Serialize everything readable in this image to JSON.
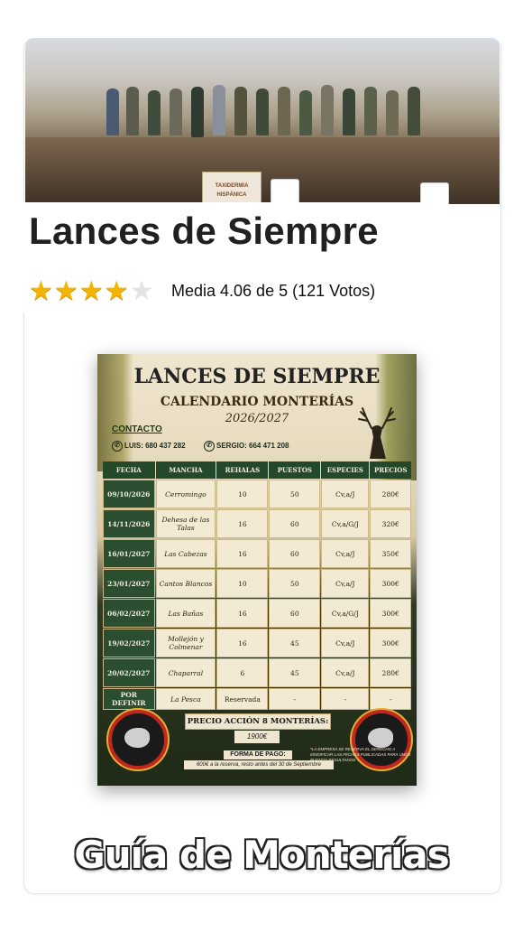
{
  "article": {
    "title": "Lances de Siempre",
    "rating_text": "Media 4.06 de 5 (121 Votos)",
    "rating_value": 4.06,
    "rating_max": 5,
    "stars_filled": 4
  },
  "hero_image": {
    "sign_text": "TAXIDERMIA HISPÁNICA"
  },
  "poster": {
    "title": "LANCES DE SIEMPRE",
    "subtitle": "CALENDARIO MONTERÍAS",
    "season": "2026/2027",
    "contact_label": "CONTACTO",
    "phones": [
      {
        "text": "LUIS: 680 437 282"
      },
      {
        "text": "SERGIO: 664 471 208"
      }
    ],
    "table": {
      "headers": [
        "FECHA",
        "MANCHA",
        "REHALAS",
        "PUESTOS",
        "ESPECIES",
        "PRECIOS"
      ],
      "rows": [
        [
          "09/10/2026",
          "Cerromingo",
          "10",
          "50",
          "Cv,a/J",
          "280€"
        ],
        [
          "14/11/2026",
          "Dehesa de las Talas",
          "16",
          "60",
          "Cv,a/G/J",
          "320€"
        ],
        [
          "16/01/2027",
          "Las Cabezas",
          "16",
          "60",
          "Cv,a/J",
          "350€"
        ],
        [
          "23/01/2027",
          "Cantos Blancos",
          "10",
          "50",
          "Cv,a/J",
          "300€"
        ],
        [
          "06/02/2027",
          "Las Bañas",
          "16",
          "60",
          "Cv,a/G/J",
          "300€"
        ],
        [
          "19/02/2027",
          "Mollejón y Colmenar",
          "16",
          "45",
          "Cv,a/J",
          "300€"
        ],
        [
          "20/02/2027",
          "Chaparral",
          "6",
          "45",
          "Cv,a/J",
          "280€"
        ],
        [
          "POR DEFINIR",
          "La Pesca",
          "Reservada",
          "-",
          "-",
          "-"
        ]
      ]
    },
    "precio_label": "PRECIO ACCIÓN 8 MONTERÍAS:",
    "precio_value": "1900€",
    "forma_label": "FORMA DE PAGO:",
    "forma_text": "600€ a la reserva, resto antes del 30 de Septiembre",
    "disclaimer": "*LA EMPRESA SE RESERVA EL DERECHO A MODIFICAR LAS FECHAS PUBLICADAS PARA UNOS BUENOS RESULTADOS"
  },
  "footer_logo": "Guía de Monterías",
  "colors": {
    "star": "#f4b400",
    "table_header": "#24482a",
    "emblem_ring": "#c0281f"
  }
}
